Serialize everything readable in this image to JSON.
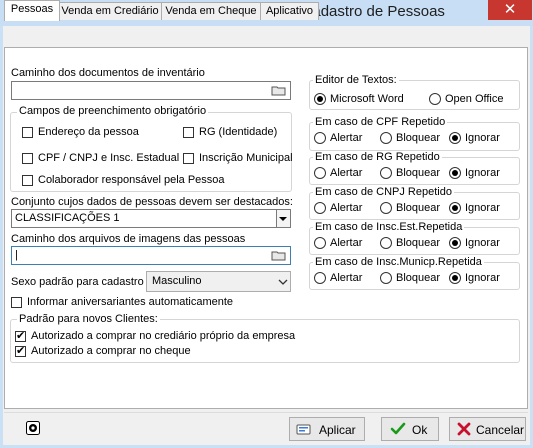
{
  "window": {
    "title": "Parâmetros de configuração do Cadastro de Pessoas",
    "close": "✕"
  },
  "tabs": [
    "Pessoas",
    "Venda em Crediário",
    "Venda em Cheque",
    "Aplicativo"
  ],
  "left": {
    "doc_path_label": "Caminho dos documentos de inventário",
    "doc_path_value": "",
    "required_group": {
      "title": "Campos de preenchimento obrigatório",
      "items": [
        {
          "label": "Endereço da pessoa",
          "checked": false
        },
        {
          "label": "RG (Identidade)",
          "checked": false
        },
        {
          "label": "CPF / CNPJ e Insc. Estadual",
          "checked": false
        },
        {
          "label": "Inscrição Municipal",
          "checked": false
        },
        {
          "label": "Colaborador responsável pela Pessoa",
          "checked": false
        }
      ]
    },
    "highlight_label": "Conjunto cujos dados de pessoas devem ser destacados:",
    "highlight_value": "CLASSIFICAÇÕES 1",
    "image_path_label": "Caminho dos arquivos de imagens das pessoas",
    "image_path_value": "|",
    "sex_label": "Sexo padrão para cadastro",
    "sex_value": "Masculino",
    "birthday_label": "Informar aniversariantes automaticamente",
    "birthday_checked": false,
    "defaults_group": {
      "title": "Padrão para novos Clientes:",
      "items": [
        {
          "label": "Autorizado a comprar no crediário próprio da empresa",
          "checked": true
        },
        {
          "label": "Autorizado a comprar no cheque",
          "checked": true
        }
      ]
    }
  },
  "right": {
    "editor": {
      "title": "Editor de Textos:",
      "options": [
        "Microsoft Word",
        "Open Office"
      ],
      "selected": 0
    },
    "duplicates": [
      {
        "title": "Em caso de CPF Repetido",
        "selected": 2
      },
      {
        "title": "Em caso de RG Repetido",
        "selected": 2
      },
      {
        "title": "Em caso de CNPJ Repetido",
        "selected": 2
      },
      {
        "title": "Em caso de Insc.Est.Repetida",
        "selected": 2
      },
      {
        "title": "Em caso de Insc.Municp.Repetida",
        "selected": 2
      }
    ],
    "dup_options": [
      "Alertar",
      "Bloquear",
      "Ignorar"
    ]
  },
  "footer": {
    "apply": "Aplicar",
    "ok": "Ok",
    "cancel": "Cancelar"
  },
  "colors": {
    "accent": "#0078d7",
    "ok_green": "#1a9a1a",
    "cancel_red": "#c8102e"
  }
}
